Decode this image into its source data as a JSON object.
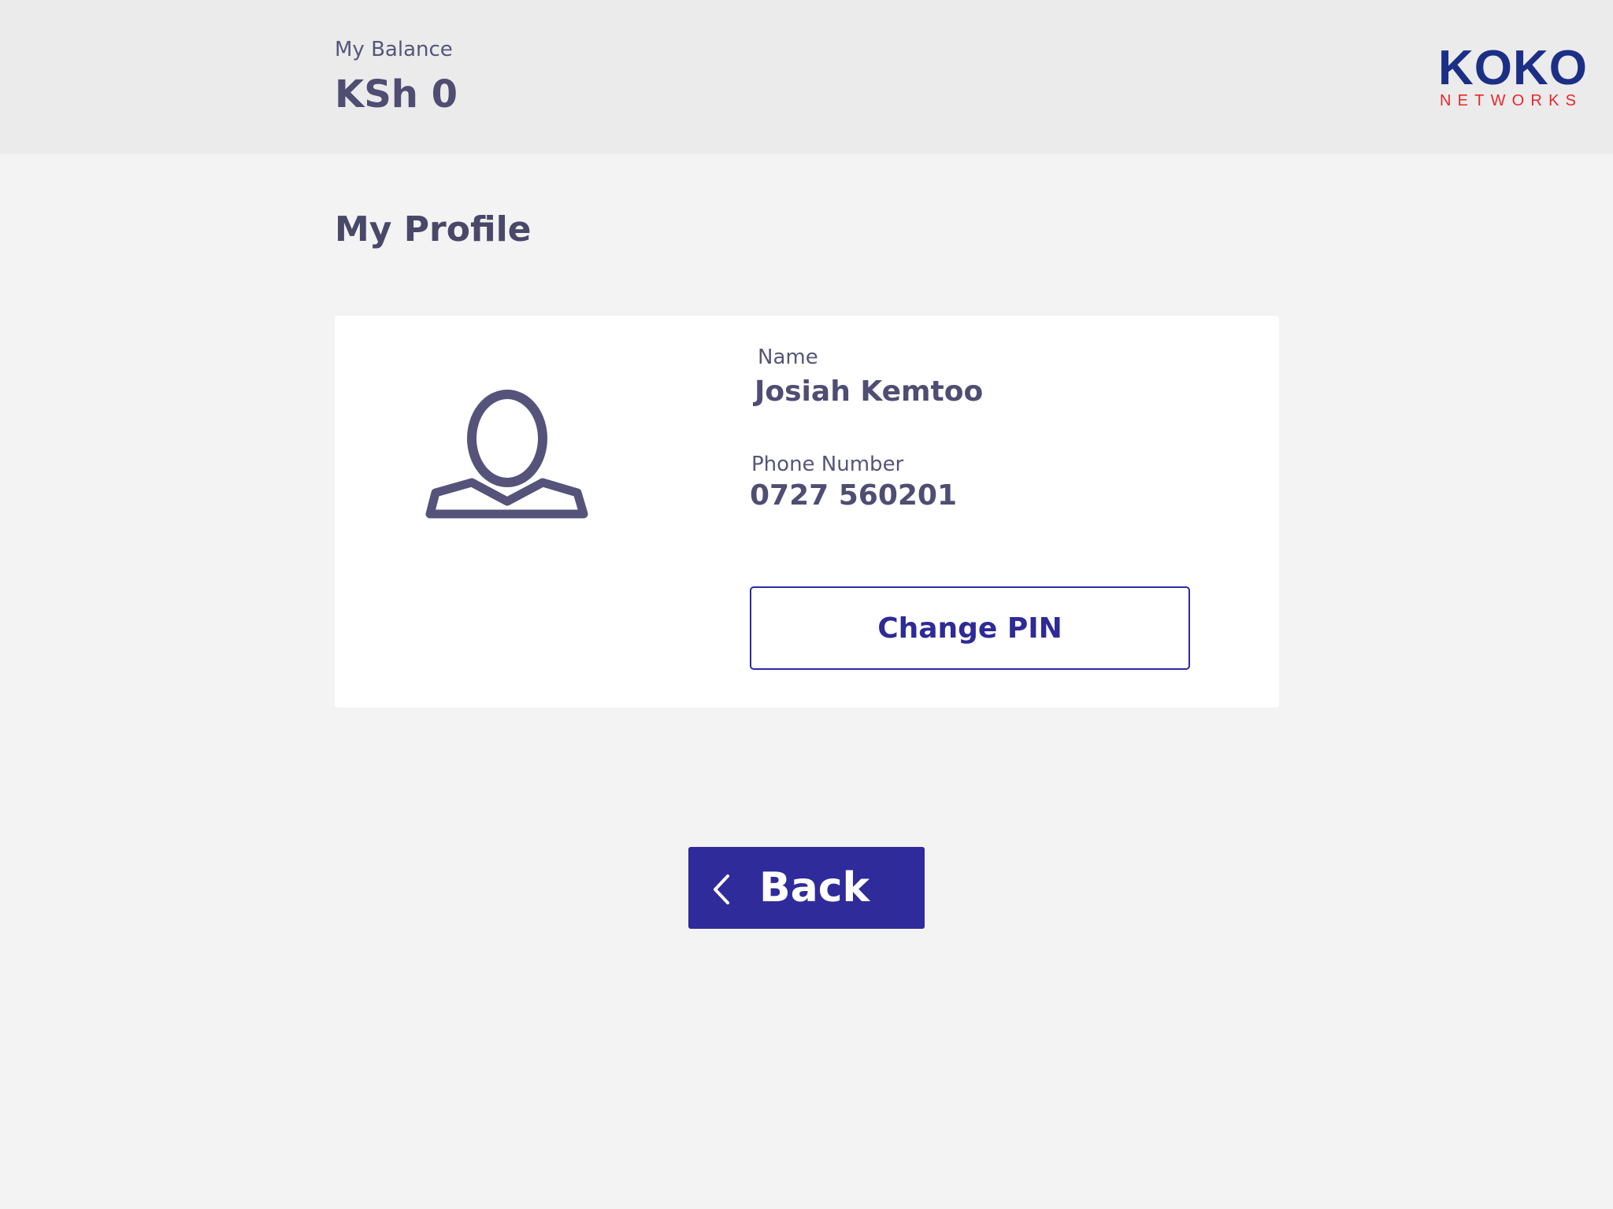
{
  "header": {
    "balance_label": "My Balance",
    "balance_value": "KSh 0",
    "logo": {
      "main": "KOKO",
      "sub": "NETWORKS"
    }
  },
  "page": {
    "title": "My Profile"
  },
  "profile": {
    "avatar_icon": "user-avatar-icon",
    "name_label": "Name",
    "name_value": "Josiah Kemtoo",
    "phone_label": "Phone Number",
    "phone_value": "0727 560201",
    "change_pin_label": "Change PIN"
  },
  "navigation": {
    "back_label": "Back",
    "back_icon": "chevron-left-icon"
  },
  "colors": {
    "primary": "#2f2b9a",
    "text": "#4f4d72",
    "brand_blue": "#1c2f86",
    "brand_red": "#e8262e",
    "header_bg": "#ebebeb",
    "page_bg": "#f3f3f3",
    "card_bg": "#ffffff"
  }
}
